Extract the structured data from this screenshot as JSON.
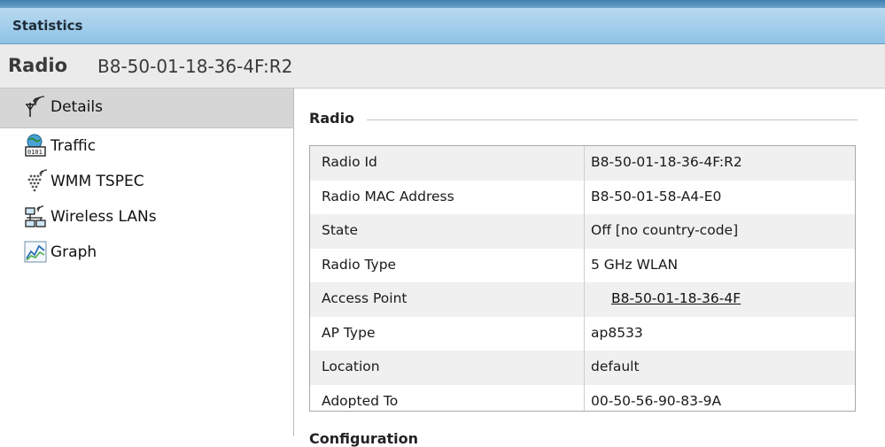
{
  "header": {
    "title": "Statistics"
  },
  "radio": {
    "label": "Radio",
    "id": "B8-50-01-18-36-4F:R2"
  },
  "sidebar": {
    "items": [
      {
        "label": "Details",
        "icon": "antenna-icon",
        "selected": true
      },
      {
        "label": "Traffic",
        "icon": "traffic-icon"
      },
      {
        "label": "WMM TSPEC",
        "icon": "wmm-tspec-icon"
      },
      {
        "label": "Wireless LANs",
        "icon": "wireless-lans-icon"
      },
      {
        "label": "Graph",
        "icon": "graph-icon"
      }
    ]
  },
  "main": {
    "section_title": "Radio",
    "next_section_title": "Configuration",
    "rows": [
      {
        "label": "Radio Id",
        "value": "B8-50-01-18-36-4F:R2"
      },
      {
        "label": "Radio MAC Address",
        "value": "B8-50-01-58-A4-E0"
      },
      {
        "label": "State",
        "value": "Off [no country-code]"
      },
      {
        "label": "Radio Type",
        "value": "5 GHz WLAN"
      },
      {
        "label": "Access Point",
        "value": "B8-50-01-18-36-4F"
      },
      {
        "label": "AP Type",
        "value": "ap8533"
      },
      {
        "label": "Location",
        "value": "default"
      },
      {
        "label": "Adopted To",
        "value": "00-50-56-90-83-9A"
      }
    ]
  }
}
